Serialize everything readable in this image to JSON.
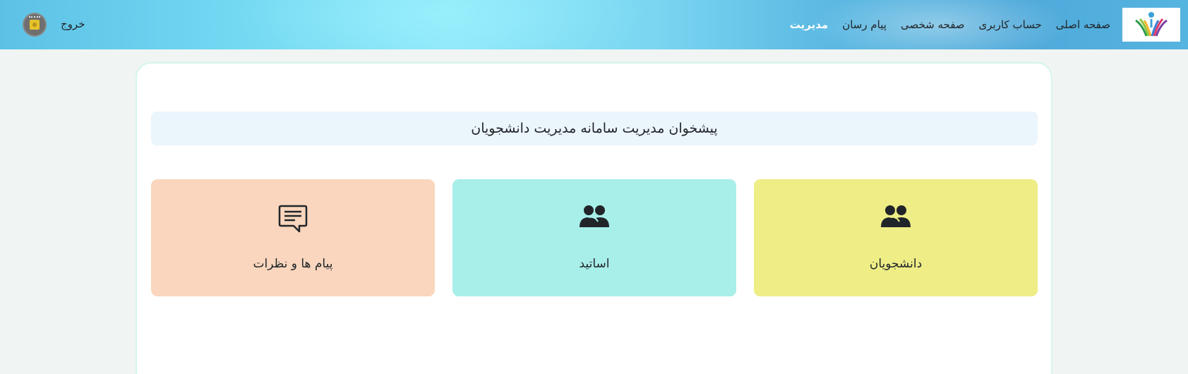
{
  "navbar": {
    "links": [
      {
        "label": "صفحه اصلی",
        "name": "nav-home"
      },
      {
        "label": "حساب کاربری",
        "name": "nav-account"
      },
      {
        "label": "صفحه شخصی",
        "name": "nav-profile"
      },
      {
        "label": "پیام رسان",
        "name": "nav-messenger"
      },
      {
        "label": "مدیریت",
        "name": "nav-management",
        "active": true
      }
    ],
    "logout_label": "خروج"
  },
  "dashboard": {
    "title": "پیشخوان مدیریت سامانه مدیریت دانشجویان",
    "cards": [
      {
        "label": "دانشجویان",
        "icon": "users-icon",
        "color": "#eeed86"
      },
      {
        "label": "اساتید",
        "icon": "users-icon",
        "color": "#a8eee9"
      },
      {
        "label": "پیام ها و نظرات",
        "icon": "chat-message-icon",
        "color": "#f9d6bd"
      }
    ]
  },
  "colors": {
    "navbar_gradient_start": "#5dc1e6",
    "navbar_gradient_end": "#4ea9da",
    "page_background": "#f0f4f3",
    "title_background": "#ebf5fc",
    "active_link": "#ffffff"
  }
}
